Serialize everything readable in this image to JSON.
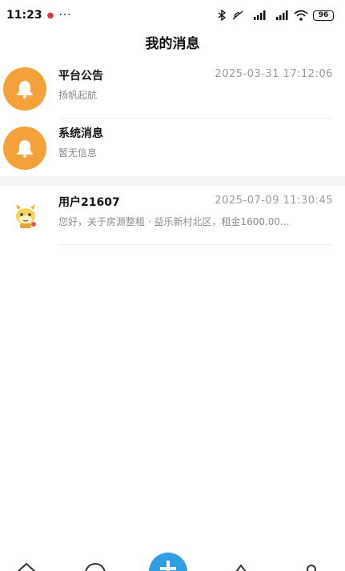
{
  "status_bar": {
    "time": "11:23",
    "more": "···",
    "battery": "96"
  },
  "header": {
    "title": "我的消息"
  },
  "messages": [
    {
      "title": "平台公告",
      "subtitle": "扬帆起航",
      "time": "2025-03-31 17:12:06",
      "avatar": "bell-icon",
      "color": "#f5a23b"
    },
    {
      "title": "系统消息",
      "subtitle": "暂无信息",
      "time": "",
      "avatar": "bell-icon",
      "color": "#f5a23b"
    },
    {
      "title": "用户21607",
      "subtitle": "您好，关于房源整租 · 益乐新村北区，租金1600.00...",
      "time": "2025-07-09 11:30:45",
      "avatar": "user-avatar-icon"
    }
  ],
  "tabbar": {
    "accent": "#2f9fe0",
    "icons": [
      "home-icon",
      "globe-icon",
      "add-icon",
      "star-icon",
      "profile-icon"
    ]
  }
}
